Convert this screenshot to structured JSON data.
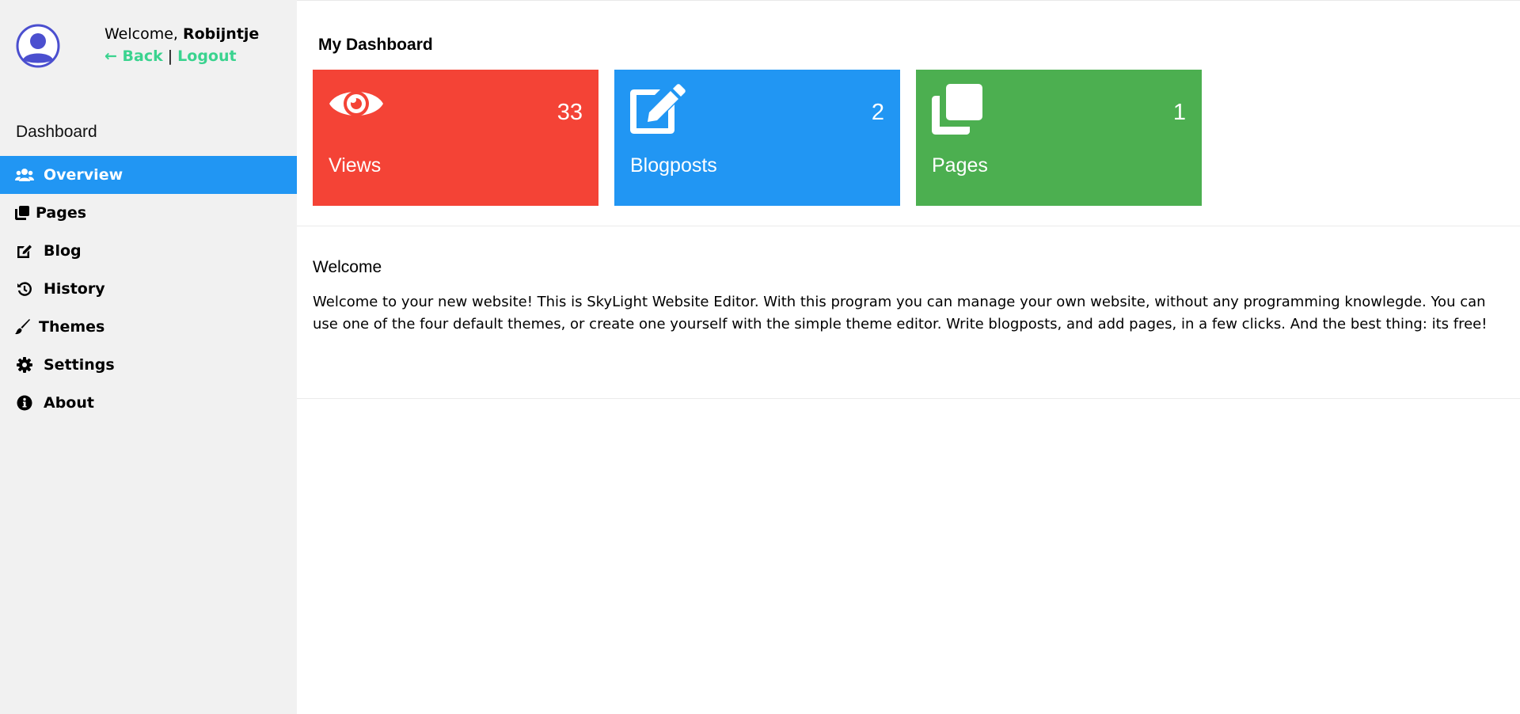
{
  "user": {
    "welcome_prefix": "Welcome,",
    "name": "Robijntje",
    "back_label": "← Back",
    "separator": "|",
    "logout_label": "Logout",
    "link_color": "#3ad38f"
  },
  "sidebar": {
    "heading": "Dashboard",
    "items": [
      {
        "label": "Overview",
        "icon": "users-icon",
        "active": true
      },
      {
        "label": "Pages",
        "icon": "copy-icon",
        "active": false
      },
      {
        "label": "Blog",
        "icon": "edit-icon",
        "active": false
      },
      {
        "label": "History",
        "icon": "history-icon",
        "active": false
      },
      {
        "label": "Themes",
        "icon": "brush-icon",
        "active": false
      },
      {
        "label": "Settings",
        "icon": "gear-icon",
        "active": false
      },
      {
        "label": "About",
        "icon": "info-icon",
        "active": false
      }
    ],
    "active_color": "#2196f3"
  },
  "main": {
    "title": "My Dashboard",
    "cards": [
      {
        "label": "Views",
        "count": "33",
        "icon": "eye-icon",
        "color": "#f44336"
      },
      {
        "label": "Blogposts",
        "count": "2",
        "icon": "edit-icon",
        "color": "#2196f3"
      },
      {
        "label": "Pages",
        "count": "1",
        "icon": "copy-icon",
        "color": "#4caf50"
      }
    ],
    "welcome": {
      "heading": "Welcome",
      "text": "Welcome to your new website! This is SkyLight Website Editor. With this program you can manage your own website, without any programming knowlegde. You can use one of the four default themes, or create one yourself with the simple theme editor. Write blogposts, and add pages, in a few clicks. And the best thing: its free!"
    }
  }
}
